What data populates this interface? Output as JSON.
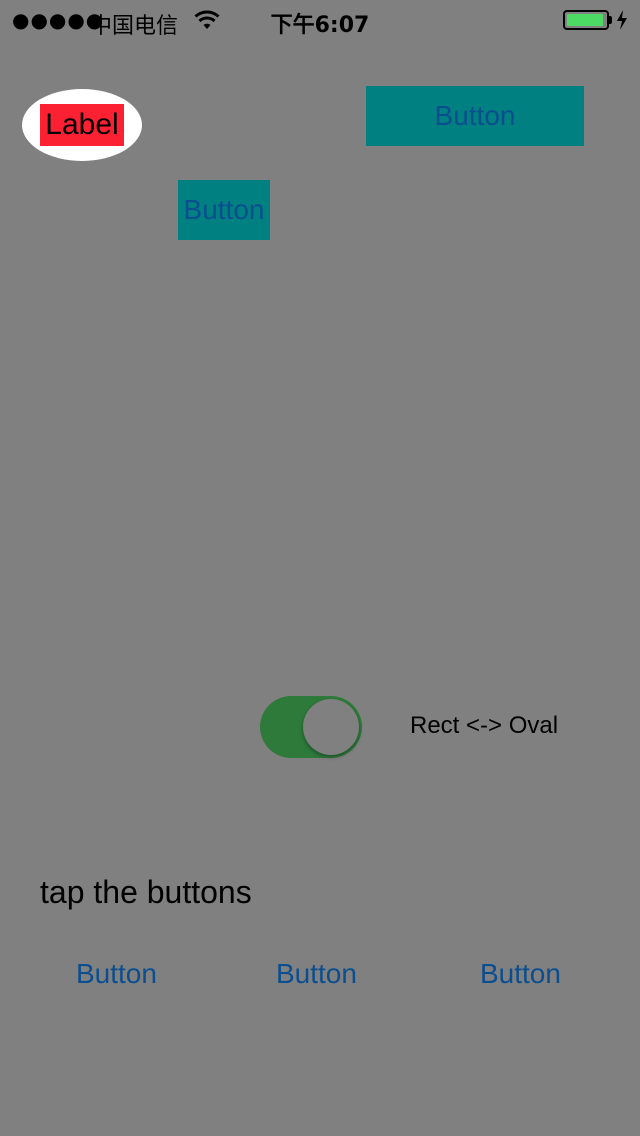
{
  "status_bar": {
    "signal": "●●●●●",
    "carrier": "中国电信",
    "time": "下午6:07",
    "battery_level": 0.95,
    "battery_color": "#4cd964",
    "icons": [
      "wifi-icon",
      "battery-icon",
      "charging-bolt-icon"
    ]
  },
  "oval_label": "Label",
  "buttons": {
    "top_right": "Button",
    "middle": "Button",
    "bottom_1": "Button",
    "bottom_2": "Button",
    "bottom_3": "Button"
  },
  "switch": {
    "on": true,
    "caption": "Rect <-> Oval",
    "on_color": "#2e7a3b"
  },
  "hint": "tap the buttons",
  "colors": {
    "background": "#808080",
    "teal": "#008080",
    "label_red": "#fc2033",
    "button_text": "#0b4e8f"
  }
}
